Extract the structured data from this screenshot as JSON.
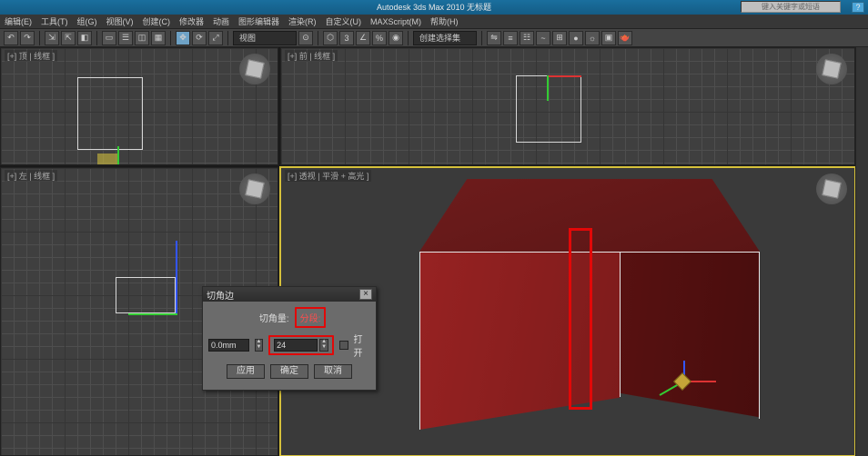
{
  "app": {
    "title": "Autodesk 3ds Max 2010  无标题",
    "search_placeholder": "键入关键字或短语"
  },
  "menu": {
    "items": [
      "编辑(E)",
      "工具(T)",
      "组(G)",
      "视图(V)",
      "创建(C)",
      "修改器",
      "动画",
      "图形编辑器",
      "渲染(R)",
      "自定义(U)",
      "MAXScript(M)",
      "帮助(H)"
    ]
  },
  "toolbar": {
    "selection_set_label": "创建选择集"
  },
  "viewports": {
    "top": "[+] 顶 | 线框 ]",
    "front": "[+] 前 | 线框 ]",
    "left": "[+] 左 | 线框 ]",
    "persp": "[+] 透视 | 平滑 + 高光 ]"
  },
  "dialog": {
    "title": "切角边",
    "chamfer_amount_label": "切角量:",
    "chamfer_amount_value": "0.0mm",
    "segments_label": "分段:",
    "segments_value": "24",
    "open_label": "打开",
    "apply": "应用",
    "ok": "确定",
    "cancel": "取消"
  }
}
